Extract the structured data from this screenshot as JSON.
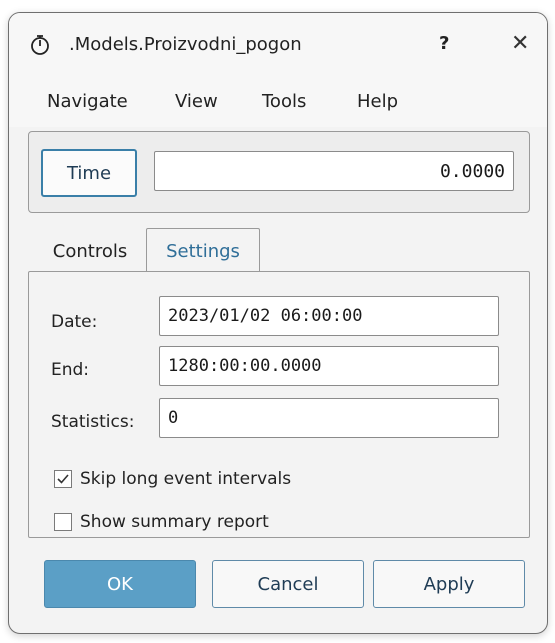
{
  "window": {
    "title": ".Models.Proizvodni_pogon",
    "help_label": "?",
    "close_label": "✕"
  },
  "menu": {
    "items": [
      "Navigate",
      "View",
      "Tools",
      "Help"
    ]
  },
  "time": {
    "button_label": "Time",
    "value": "0.0000"
  },
  "tabs": [
    {
      "label": "Controls",
      "selected": false
    },
    {
      "label": "Settings",
      "selected": true
    }
  ],
  "settings": {
    "date_label": "Date:",
    "date_value": "2023/01/02 06:00:00",
    "end_label": "End:",
    "end_value": "1280:00:00.0000",
    "statistics_label": "Statistics:",
    "statistics_value": "0",
    "skip_long_label": "Skip long event intervals",
    "skip_long_checked": true,
    "summary_label": "Show summary report",
    "summary_checked": false
  },
  "buttons": {
    "ok": "OK",
    "cancel": "Cancel",
    "apply": "Apply"
  },
  "colors": {
    "accent": "#5b9fc6",
    "tab_text": "#2f6e98",
    "border": "#9a9a9a"
  }
}
